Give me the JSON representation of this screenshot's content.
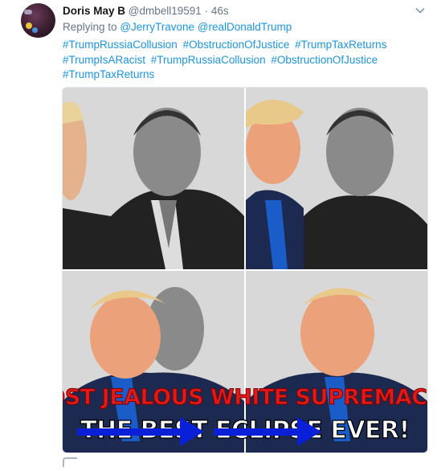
{
  "tweet": {
    "author_name": "Doris May B",
    "author_handle": "@dmbell19591",
    "separator": "·",
    "timestamp": "46s",
    "reply_prefix": "Replying to",
    "reply_to": [
      "@JerryTravone",
      "@realDonaldTrump"
    ],
    "hashtags": [
      "#TrumpRussiaCollusion",
      "#ObstructionOfJustice",
      "#TrumpTaxReturns",
      "#TrumpIsARacist",
      "#TrumpRussiaCollusion",
      "#ObstructionOfJustice",
      "#TrumpTaxReturns"
    ],
    "media": {
      "meme_line_1": "MOST JEALOUS WHITE SUPREMACIST",
      "meme_line_2": "THE BEST ECLIPSE EVER!"
    }
  },
  "icons": {
    "menu": "chevron-down-icon",
    "reply": "reply-icon"
  },
  "colors": {
    "link": "#1b95e0",
    "secondary_text": "#657786",
    "name_text": "#14171a",
    "meme_red": "#e01919",
    "arrow_blue": "#0a1fd8"
  }
}
